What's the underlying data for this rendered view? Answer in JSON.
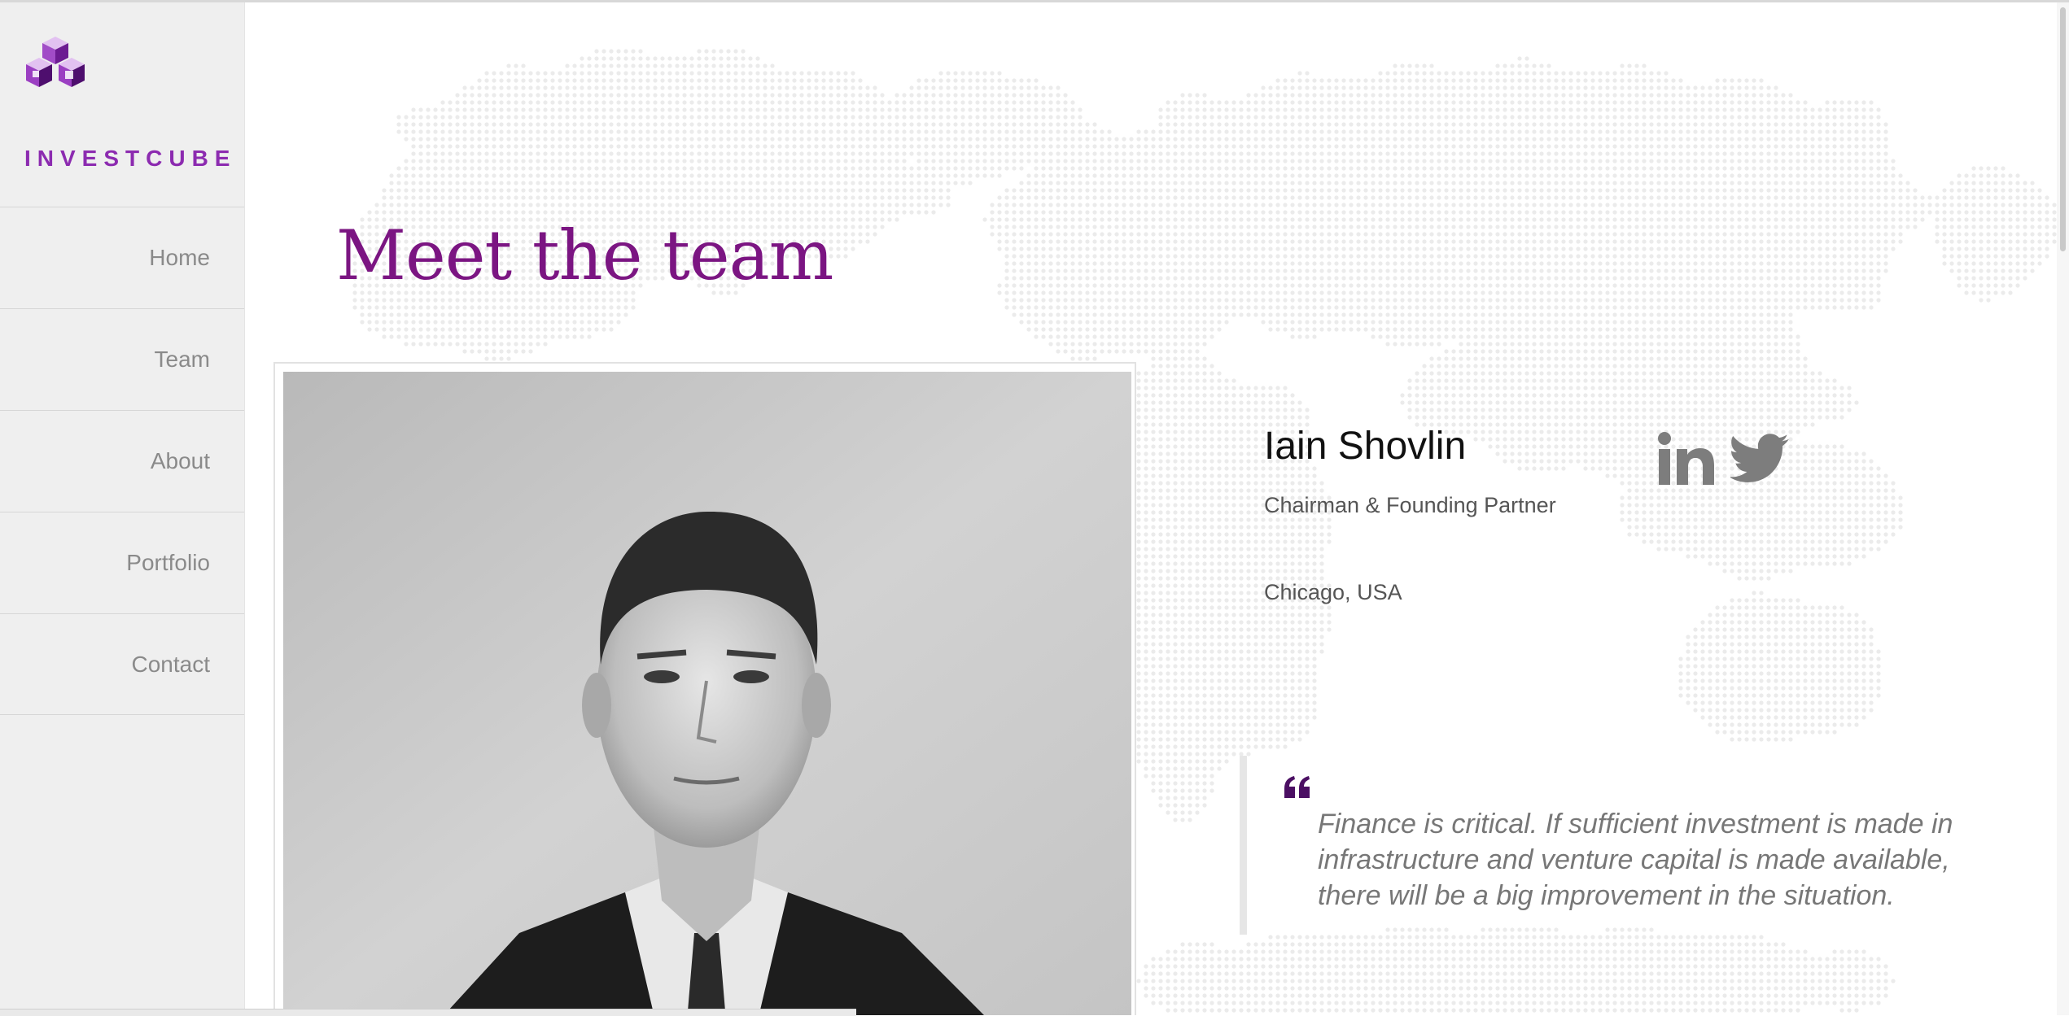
{
  "brand": {
    "name": "INVESTCUBE",
    "logo_icon": "cube-stack-logo",
    "accent": "#8c2bb0"
  },
  "nav": {
    "items": [
      {
        "label": "Home"
      },
      {
        "label": "Team"
      },
      {
        "label": "About"
      },
      {
        "label": "Portfolio"
      },
      {
        "label": "Contact"
      }
    ]
  },
  "page": {
    "title": "Meet the team",
    "title_color": "#7b1582"
  },
  "member": {
    "name": "Iain Shovlin",
    "role": "Chairman & Founding Partner",
    "location": "Chicago, USA",
    "photo": "member-portrait",
    "social": [
      {
        "icon": "linkedin-icon"
      },
      {
        "icon": "twitter-icon"
      }
    ],
    "quote_icon": "quote-open-icon",
    "quote": "Finance is critical. If sufficient investment is made in infrastructure and venture capital is made available, there will be a big improvement in the situation."
  },
  "background": {
    "map": "world-dot-map"
  }
}
